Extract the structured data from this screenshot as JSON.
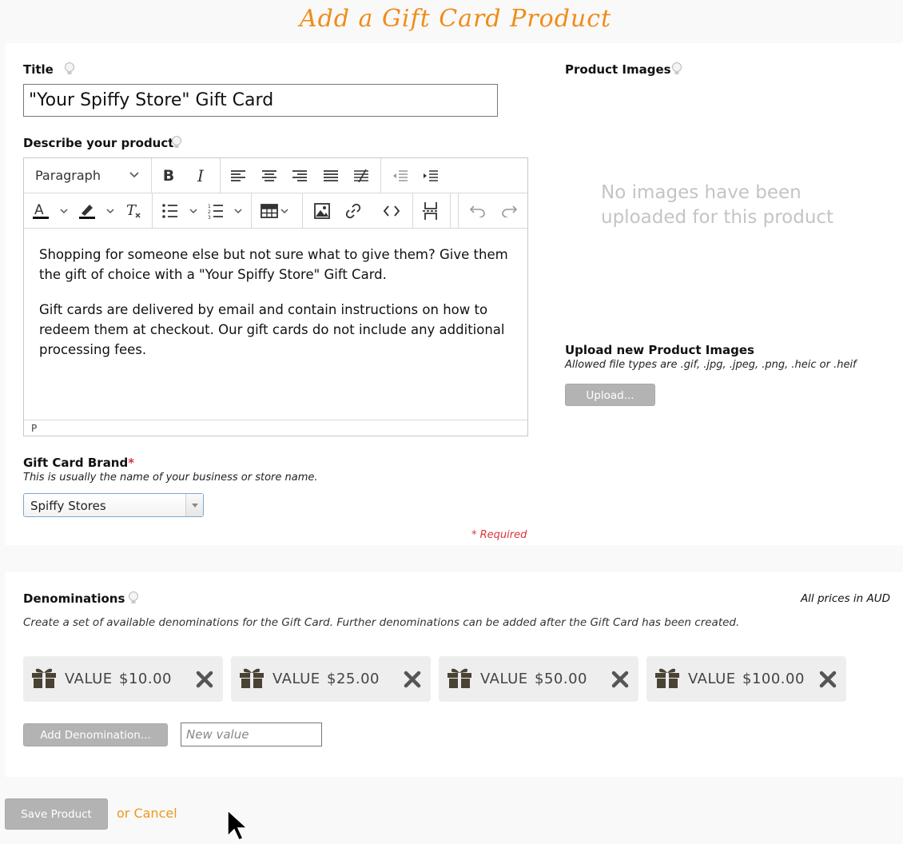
{
  "page": {
    "title": "Add a Gift Card Product"
  },
  "title_field": {
    "label": "Title",
    "value": "\"Your Spiffy Store\" Gift Card"
  },
  "description": {
    "label": "Describe your product",
    "toolbar": {
      "paragraph_format": "Paragraph",
      "row1_icons": [
        "bold-icon",
        "italic-icon",
        "align-left-icon",
        "align-center-icon",
        "align-right-icon",
        "align-justify-icon",
        "clear-alignment-icon",
        "outdent-icon",
        "indent-icon"
      ],
      "row2_icons": [
        "text-color-icon",
        "highlight-icon",
        "clear-format-icon",
        "bullet-list-icon",
        "numbered-list-icon",
        "table-icon",
        "image-icon",
        "link-icon",
        "code-icon",
        "page-break-icon",
        "undo-icon",
        "redo-icon"
      ]
    },
    "paragraphs": [
      "Shopping for someone else but not sure what to give them? Give them the gift of choice with a \"Your Spiffy Store\" Gift Card.",
      "Gift cards are delivered by email and contain instructions on how to redeem them at checkout. Our gift cards do not include any additional processing fees."
    ],
    "status_path": "P"
  },
  "brand": {
    "label": "Gift Card Brand",
    "required_marker": "*",
    "help": "This is usually the name of your business or store name.",
    "selected": "Spiffy Stores"
  },
  "required_note": "* Required",
  "images": {
    "label": "Product Images",
    "empty_message": "No images have been uploaded for this product",
    "upload_label": "Upload new Product Images",
    "upload_help": "Allowed file types are .gif, .jpg, .jpeg, .png, .heic or .heif",
    "upload_button": "Upload..."
  },
  "denominations": {
    "label": "Denominations",
    "prices_note": "All prices in AUD",
    "help": "Create a set of available denominations for the Gift Card. Further denominations can be added after the Gift Card has been created.",
    "value_label": "VALUE",
    "items": [
      {
        "amount": "$10.00"
      },
      {
        "amount": "$25.00"
      },
      {
        "amount": "$50.00"
      },
      {
        "amount": "$100.00"
      }
    ],
    "add_button": "Add Denomination...",
    "new_value_placeholder": "New value"
  },
  "actions": {
    "save": "Save Product",
    "cancel": "or Cancel"
  },
  "colors": {
    "accent": "#f08c1a",
    "required": "#d8343b",
    "button_grey": "#b3b3b3"
  }
}
